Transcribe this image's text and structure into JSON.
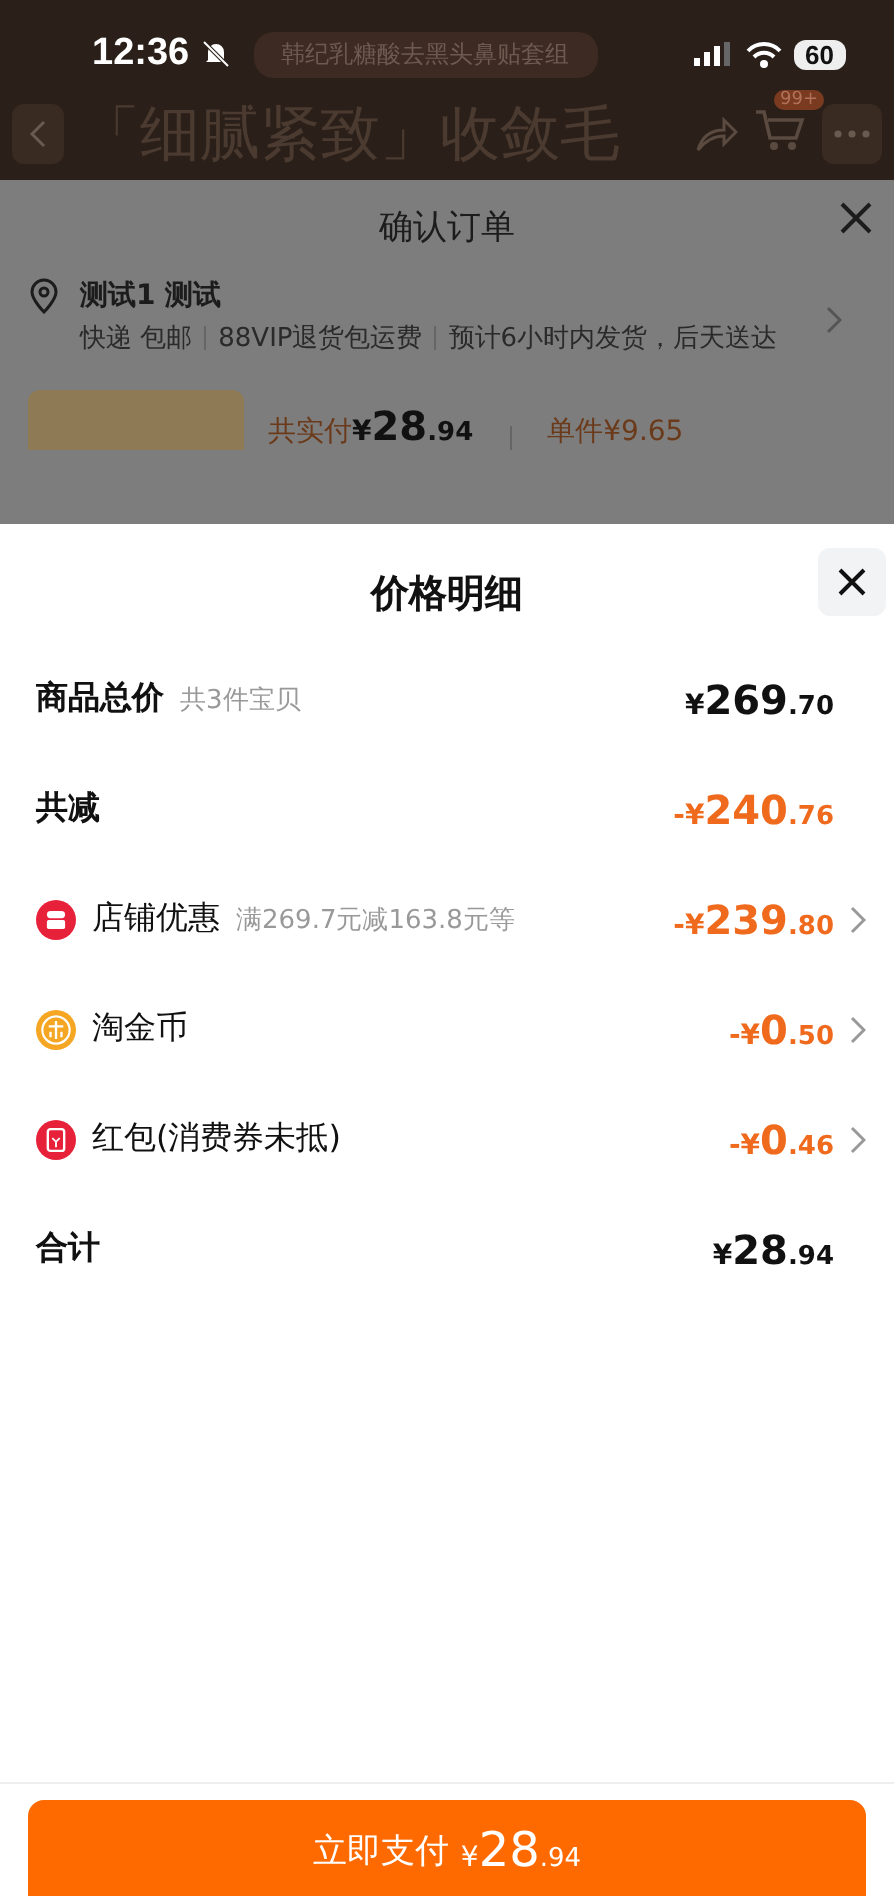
{
  "status_bar": {
    "time": "12:36",
    "battery": "60"
  },
  "product_page": {
    "pill": "韩纪乳糖酸去黑头鼻贴套组",
    "headline": "「细腻紧致」收敛毛",
    "cart_badge": "99+"
  },
  "order_sheet": {
    "title": "确认订单",
    "address": {
      "name": "测试1 测试",
      "delivery": [
        "快递 包邮",
        "88VIP退货包运费",
        "预计6小时内发货，后天送达"
      ]
    },
    "product": {
      "paid_label": "共实付",
      "paid": {
        "currency": "¥",
        "integer": "28",
        "decimal": ".94"
      },
      "unit": "单件¥9.65"
    }
  },
  "price_sheet": {
    "title": "价格明细",
    "rows": [
      {
        "kind": "plain",
        "label": "商品总价",
        "note": "共3件宝贝",
        "discount": false,
        "has_detail": false,
        "amount": {
          "currency": "¥",
          "integer": "269",
          "decimal": ".70"
        }
      },
      {
        "kind": "plain",
        "label": "共减",
        "discount": true,
        "has_detail": false,
        "amount": {
          "currency": "-¥",
          "integer": "240",
          "decimal": ".76"
        }
      },
      {
        "kind": "shop",
        "label": "店铺优惠",
        "note": "满269.7元减163.8元等",
        "discount": true,
        "has_detail": true,
        "amount": {
          "currency": "-¥",
          "integer": "239",
          "decimal": ".80"
        }
      },
      {
        "kind": "coin",
        "label": "淘金币",
        "discount": true,
        "has_detail": true,
        "amount": {
          "currency": "-¥",
          "integer": "0",
          "decimal": ".50"
        }
      },
      {
        "kind": "red_packet",
        "label": "红包(消费券未抵)",
        "discount": true,
        "has_detail": true,
        "amount": {
          "currency": "-¥",
          "integer": "0",
          "decimal": ".46"
        }
      },
      {
        "kind": "plain",
        "label": "合计",
        "discount": false,
        "has_detail": false,
        "amount": {
          "currency": "¥",
          "integer": "28",
          "decimal": ".94"
        }
      }
    ],
    "pay_button": {
      "label": "立即支付",
      "amount": {
        "currency": "¥",
        "integer": "28",
        "decimal": ".94"
      }
    }
  }
}
